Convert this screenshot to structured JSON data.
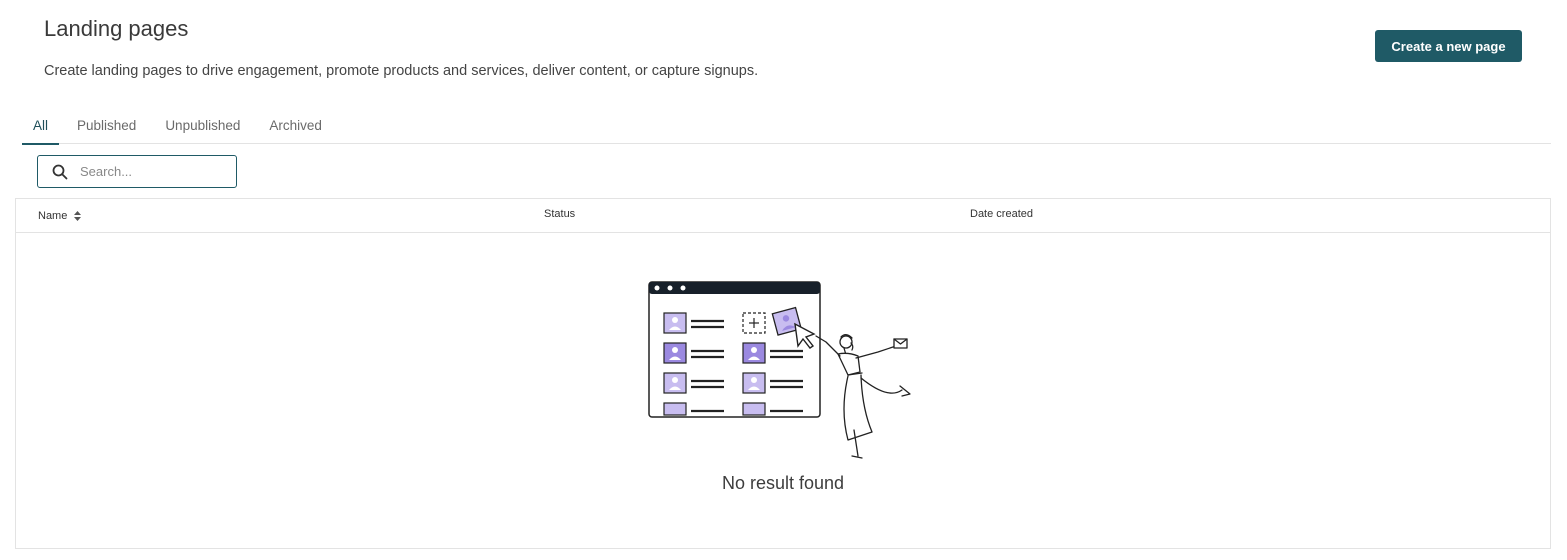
{
  "header": {
    "title": "Landing pages",
    "description": "Create landing pages to drive engagement, promote products and services, deliver content, or capture signups.",
    "create_button": "Create a new page"
  },
  "tabs": [
    {
      "label": "All",
      "active": true
    },
    {
      "label": "Published",
      "active": false
    },
    {
      "label": "Unpublished",
      "active": false
    },
    {
      "label": "Archived",
      "active": false
    }
  ],
  "search": {
    "placeholder": "Search...",
    "value": ""
  },
  "table": {
    "columns": [
      "Name",
      "Status",
      "Date created"
    ],
    "rows": [],
    "empty_message": "No result found"
  },
  "colors": {
    "accent": "#1f5a66",
    "illustration_purple": "#9b89e0"
  }
}
